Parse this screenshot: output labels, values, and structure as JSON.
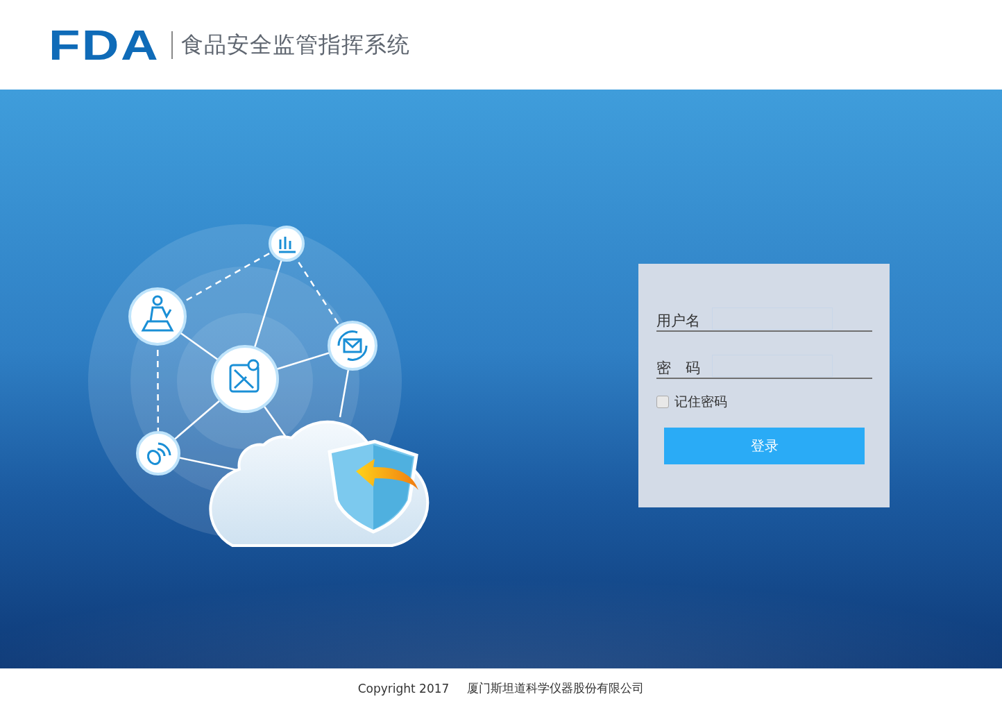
{
  "header": {
    "logo": "FDA",
    "title": "食品安全监管指挥系统"
  },
  "login": {
    "fields": [
      {
        "label": "用户名"
      },
      {
        "label": "密　码"
      }
    ],
    "remember": {
      "label": "记住密码",
      "checked": false
    },
    "button": "登录"
  },
  "footer": {
    "copyright": "Copyright 2017",
    "company": "厦门斯坦道科学仪器股份有限公司"
  }
}
